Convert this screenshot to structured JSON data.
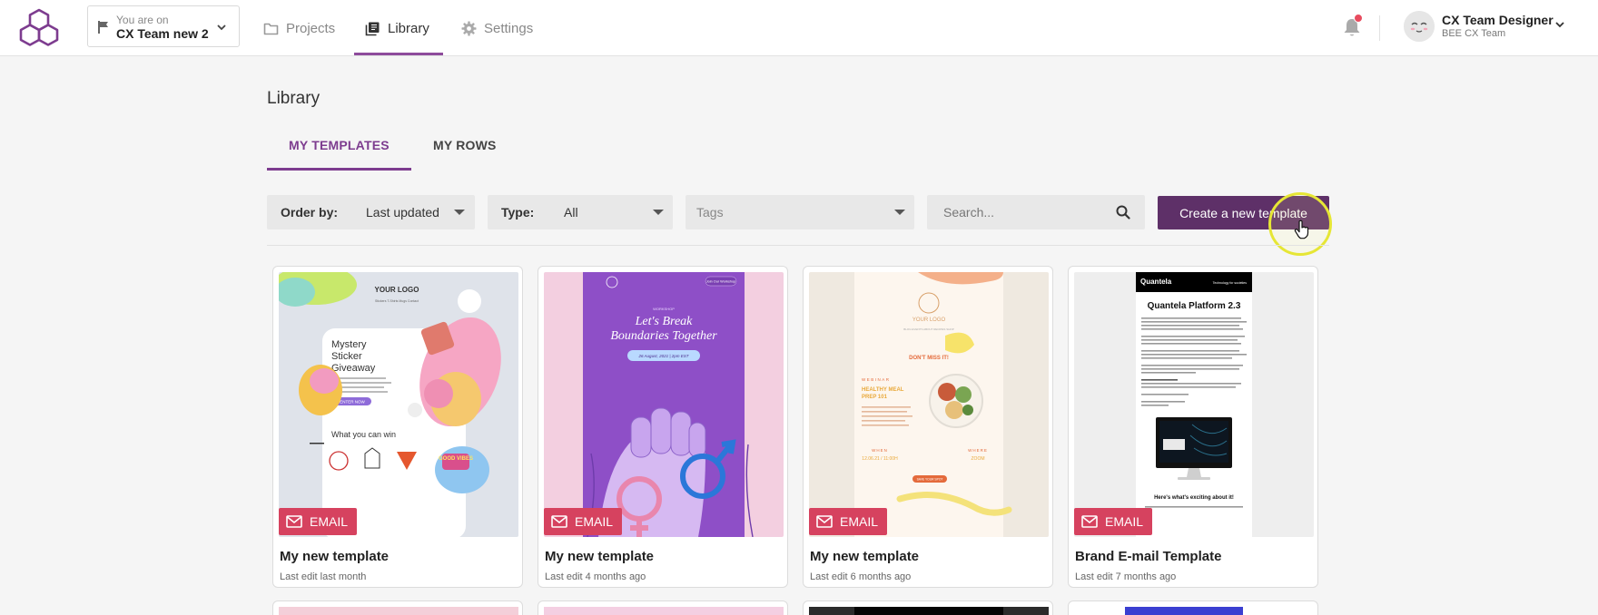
{
  "header": {
    "project_switch": {
      "caption": "You are on",
      "name": "CX Team new 2"
    },
    "nav": [
      {
        "label": "Projects",
        "icon": "folder-icon"
      },
      {
        "label": "Library",
        "icon": "library-icon"
      },
      {
        "label": "Settings",
        "icon": "gear-icon"
      }
    ],
    "user": {
      "name": "CX Team Designer",
      "team": "BEE CX Team"
    },
    "accent_color": "#8e4b9c",
    "notification_dot_color": "#e84c5f"
  },
  "page": {
    "title": "Library",
    "tabs": [
      {
        "label": "MY TEMPLATES",
        "active": true
      },
      {
        "label": "MY ROWS",
        "active": false
      }
    ],
    "filters": {
      "order_label": "Order by:",
      "order_value": "Last updated",
      "type_label": "Type:",
      "type_value": "All",
      "tags_placeholder": "Tags",
      "search_placeholder": "Search..."
    },
    "create_button": "Create a new template",
    "create_button_color": "#5e3068"
  },
  "templates": [
    {
      "badge": "EMAIL",
      "title": "My new template",
      "meta": "Last edit last month",
      "preview": {
        "logo": "YOUR LOGO",
        "headline": [
          "Mystery",
          "Sticker",
          "Giveaway"
        ],
        "cta": "ENTER NOW",
        "section": "What you can win",
        "sticker": "GOOD VIBES"
      }
    },
    {
      "badge": "EMAIL",
      "title": "My new template",
      "meta": "Last edit 4 months ago",
      "preview": {
        "kicker": "WORKSHOP",
        "headline": [
          "Let's Break",
          "Boundaries Together"
        ],
        "date": "26 August, 2021 | 2pm EST",
        "cta": "Join Our Workshop"
      }
    },
    {
      "badge": "EMAIL",
      "title": "My new template",
      "meta": "Last edit 6 months ago",
      "preview": {
        "logo": "YOUR LOGO",
        "callout": "DON'T MISS IT!",
        "kicker": "WEBINAR",
        "headline": [
          "HEALTHY MEAL",
          "PREP 101"
        ],
        "when_label": "WHEN",
        "when": "12.06.21 / 11:00H",
        "where_label": "WHERE",
        "where": "ZOOM",
        "cta": "SAVE YOUR SPOT"
      }
    },
    {
      "badge": "EMAIL",
      "title": "Brand E-mail Template",
      "meta": "Last edit 7 months ago",
      "preview": {
        "brand": "Quantela",
        "tagline": "Technology for societies",
        "headline": "Quantela Platform 2.3",
        "footer": "Here's what's exciting about it!"
      }
    }
  ]
}
